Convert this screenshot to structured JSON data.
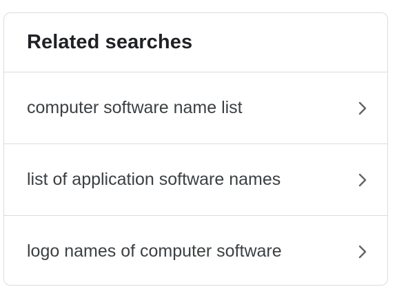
{
  "related_searches": {
    "title": "Related searches",
    "items": [
      {
        "label": "computer software name list",
        "icon": "chevron-right-icon"
      },
      {
        "label": "list of application software names",
        "icon": "chevron-right-icon"
      },
      {
        "label": "logo names of computer software",
        "icon": "chevron-right-icon"
      }
    ]
  },
  "colors": {
    "border": "#dadce0",
    "title_text": "#202124",
    "item_text": "#3c4043",
    "chevron": "#5f6368"
  }
}
